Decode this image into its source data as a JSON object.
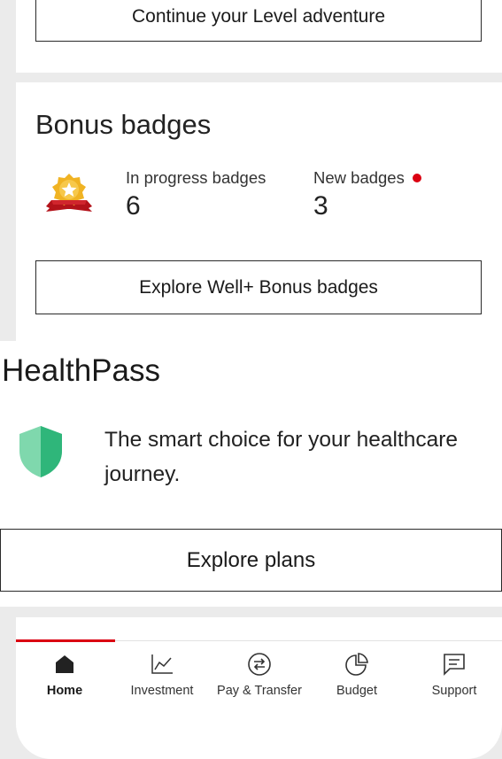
{
  "level_card": {
    "continue_button": "Continue your Level adventure"
  },
  "bonus_badges": {
    "title": "Bonus badges",
    "in_progress_label": "In progress badges",
    "in_progress_count": "6",
    "new_label": "New badges",
    "new_count": "3",
    "explore_button": "Explore Well+ Bonus badges",
    "icon": "award-badge-icon"
  },
  "healthpass": {
    "title": "HealthPass",
    "description": "The smart choice for your healthcare journey.",
    "explore_button": "Explore plans",
    "icon": "shield-icon"
  },
  "bottom_nav": {
    "active": "Home",
    "items": [
      {
        "label": "Home",
        "icon": "home-icon"
      },
      {
        "label": "Investment",
        "icon": "chart-line-icon"
      },
      {
        "label": "Pay & Transfer",
        "icon": "transfer-icon"
      },
      {
        "label": "Budget",
        "icon": "pie-chart-icon"
      },
      {
        "label": "Support",
        "icon": "chat-icon"
      }
    ]
  },
  "colors": {
    "accent_red": "#db0011",
    "shield_green": "#2fb67a",
    "shield_light_green": "#7fd8ad",
    "badge_gold": "#f0b323"
  }
}
